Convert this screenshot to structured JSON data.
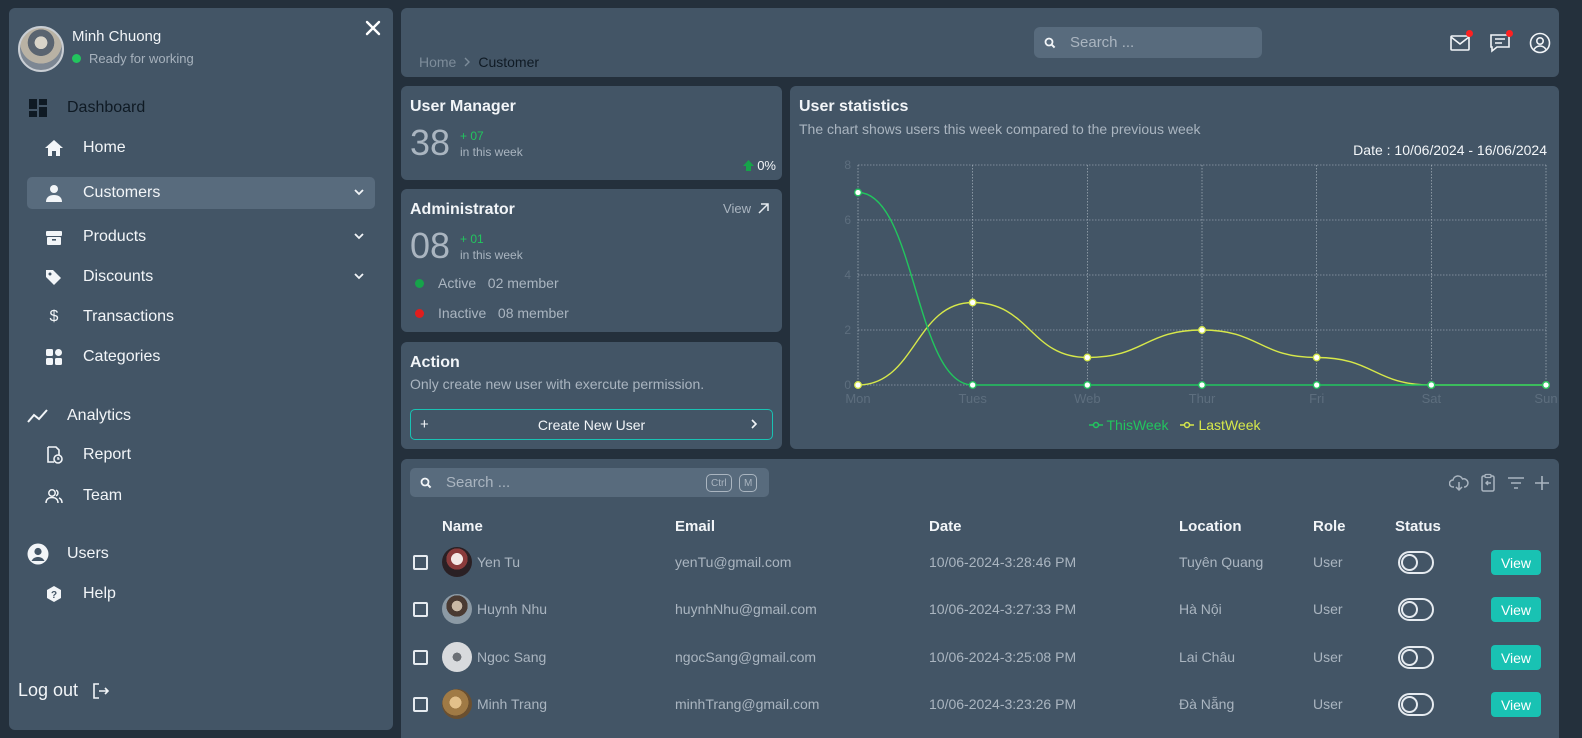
{
  "colors": {
    "accent": "#19c2b3",
    "this_week": "#22c55e",
    "last_week": "#d7e84a",
    "active": "#16a34a",
    "inactive": "#e11d1d"
  },
  "sidebar": {
    "user_name": "Minh Chuong",
    "user_status": "Ready for working",
    "dashboard_label": "Dashboard",
    "items": [
      {
        "label": "Home",
        "icon": "home-icon"
      },
      {
        "label": "Customers",
        "icon": "user-icon"
      },
      {
        "label": "Products",
        "icon": "box-icon"
      },
      {
        "label": "Discounts",
        "icon": "tag-icon"
      },
      {
        "label": "Transactions",
        "icon": "dollar-icon"
      },
      {
        "label": "Categories",
        "icon": "grid-icon"
      }
    ],
    "analytics_label": "Analytics",
    "analytics_items": [
      {
        "label": "Report",
        "icon": "report-icon"
      },
      {
        "label": "Team",
        "icon": "team-icon"
      }
    ],
    "users_label": "Users",
    "help_label": "Help",
    "logout_label": "Log out"
  },
  "header": {
    "search_placeholder": "Search ...",
    "breadcrumb_home": "Home",
    "breadcrumb_current": "Customer"
  },
  "user_manager": {
    "title": "User Manager",
    "count": "38",
    "delta": "+ 07",
    "delta_label": "in this week",
    "percent": "0%"
  },
  "administrator": {
    "title": "Administrator",
    "view_label": "View",
    "count": "08",
    "delta": "+ 01",
    "delta_label": "in this week",
    "active_label": "Active",
    "active_count": "02 member",
    "inactive_label": "Inactive",
    "inactive_count": "08 member"
  },
  "action": {
    "title": "Action",
    "description": "Only create new user with exercute permission.",
    "button_label": "Create New User"
  },
  "stats": {
    "title": "User statistics",
    "subtitle": "The chart shows users this week compared to the previous week",
    "date_range": "Date : 10/06/2024 - 16/06/2024"
  },
  "chart_data": {
    "type": "line",
    "categories": [
      "Mon",
      "Tues",
      "Web",
      "Thur",
      "Fri",
      "Sat",
      "Sun"
    ],
    "series": [
      {
        "name": "ThisWeek",
        "values": [
          7,
          0,
          0,
          0,
          0,
          0,
          0
        ]
      },
      {
        "name": "LastWeek",
        "values": [
          0,
          3,
          1,
          2,
          1,
          0,
          0
        ]
      }
    ],
    "ylim": [
      0,
      8
    ],
    "yticks": [
      0,
      2,
      4,
      6,
      8
    ],
    "grid": true,
    "legend": "bottom"
  },
  "table": {
    "search_placeholder": "Search ...",
    "shortcut_keys": [
      "Ctrl",
      "M"
    ],
    "columns": [
      "Name",
      "Email",
      "Date",
      "Location",
      "Role",
      "Status"
    ],
    "view_label": "View",
    "rows": [
      {
        "name": "Yen Tu",
        "email": "yenTu@gmail.com",
        "date": "10/06-2024-3:28:46 PM",
        "location": "Tuyên Quang",
        "role": "User"
      },
      {
        "name": "Huynh Nhu",
        "email": "huynhNhu@gmail.com",
        "date": "10/06-2024-3:27:33 PM",
        "location": "Hà Nội",
        "role": "User"
      },
      {
        "name": "Ngoc Sang",
        "email": "ngocSang@gmail.com",
        "date": "10/06-2024-3:25:08 PM",
        "location": "Lai Châu",
        "role": "User"
      },
      {
        "name": "Minh Trang",
        "email": "minhTrang@gmail.com",
        "date": "10/06-2024-3:23:26 PM",
        "location": "Đà Nẵng",
        "role": "User"
      }
    ]
  }
}
